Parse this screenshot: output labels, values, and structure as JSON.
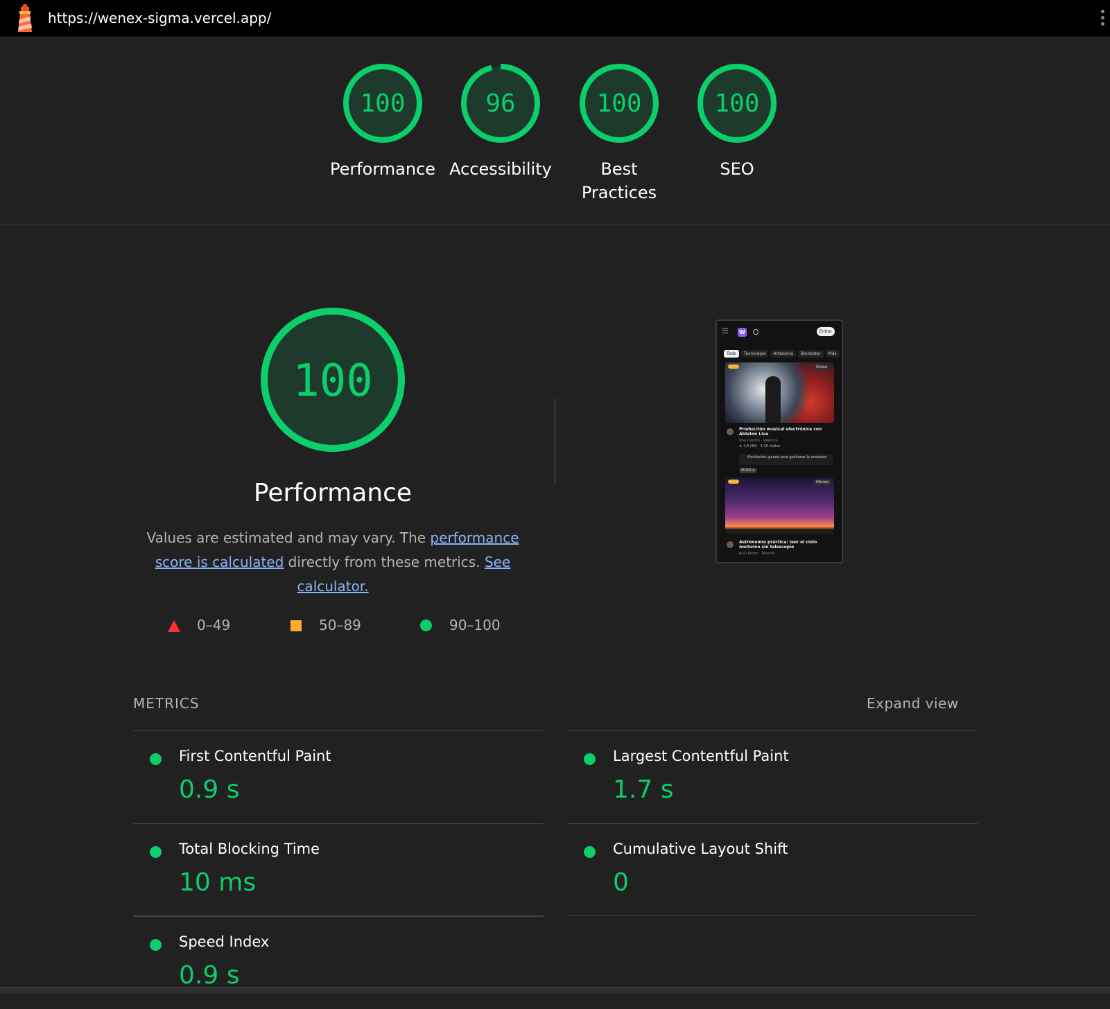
{
  "topbar": {
    "url": "https://wenex-sigma.vercel.app/"
  },
  "colors": {
    "pass": "#0cce6b",
    "average": "#ffaa33",
    "fail": "#ff3333",
    "link": "#8ab4f8"
  },
  "categories": [
    {
      "label": "Performance",
      "score": "100",
      "value": 100
    },
    {
      "label": "Accessibility",
      "score": "96",
      "value": 96
    },
    {
      "label": "Best Practices",
      "score": "100",
      "value": 100
    },
    {
      "label": "SEO",
      "score": "100",
      "value": 100
    }
  ],
  "performance": {
    "score": "100",
    "value": 100,
    "title": "Performance",
    "desc_prefix": "Values are estimated and may vary. The ",
    "desc_link1": "performance score is calculated",
    "desc_middle": " directly from these metrics. ",
    "desc_link2": "See calculator.",
    "legend": [
      {
        "range": "0–49",
        "icon": "triangle-icon"
      },
      {
        "range": "50–89",
        "icon": "square-icon"
      },
      {
        "range": "90–100",
        "icon": "circle-icon"
      }
    ]
  },
  "thumbnail": {
    "logo": "W",
    "button": "Entrar",
    "tabs": [
      "Todo",
      "Tecnología",
      "Artesanía",
      "Bienestar",
      "Más"
    ],
    "chip1": "Online",
    "card1_title": "Producción musical electrónica con Ableton Live",
    "card1_sub": "Noa Castillo · Valencia",
    "card1_meta": "★ 4,8 (96) · 4.1K visitas",
    "card1_note": "Meditación guiada para gestionar la ansiedad",
    "card1_tag": "MÚSICA",
    "chip2": "Híbrido",
    "card2_title": "Astronomía práctica: leer el cielo nocturno sin telescopio",
    "card2_sub": "Raúl Ferrer · Tenerife"
  },
  "metrics": {
    "heading": "METRICS",
    "expand_label": "Expand view",
    "items": [
      {
        "name": "First Contentful Paint",
        "value": "0.9 s"
      },
      {
        "name": "Largest Contentful Paint",
        "value": "1.7 s"
      },
      {
        "name": "Total Blocking Time",
        "value": "10 ms"
      },
      {
        "name": "Cumulative Layout Shift",
        "value": "0"
      },
      {
        "name": "Speed Index",
        "value": "0.9 s"
      }
    ]
  }
}
